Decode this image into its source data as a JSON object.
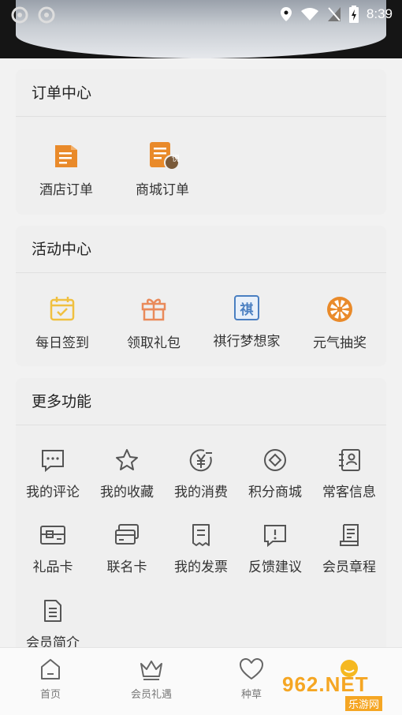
{
  "status_bar": {
    "time": "8:39"
  },
  "order_center": {
    "title": "订单中心",
    "items": [
      {
        "label": "酒店订单",
        "icon": "hotel-order-icon"
      },
      {
        "label": "商城订单",
        "icon": "mall-order-icon",
        "badge": "悦"
      }
    ]
  },
  "activity_center": {
    "title": "活动中心",
    "items": [
      {
        "label": "每日签到",
        "icon": "calendar-check-icon"
      },
      {
        "label": "领取礼包",
        "icon": "gift-icon"
      },
      {
        "label": "祺行梦想家",
        "icon": "qi-icon",
        "glyph": "祺"
      },
      {
        "label": "元气抽奖",
        "icon": "lottery-wheel-icon"
      }
    ]
  },
  "more_functions": {
    "title": "更多功能",
    "items": [
      {
        "label": "我的评论",
        "icon": "comment-icon"
      },
      {
        "label": "我的收藏",
        "icon": "star-icon"
      },
      {
        "label": "我的消费",
        "icon": "yen-icon"
      },
      {
        "label": "积分商城",
        "icon": "points-icon"
      },
      {
        "label": "常客信息",
        "icon": "contact-card-icon"
      },
      {
        "label": "礼品卡",
        "icon": "gift-card-icon"
      },
      {
        "label": "联名卡",
        "icon": "credit-card-icon"
      },
      {
        "label": "我的发票",
        "icon": "invoice-icon"
      },
      {
        "label": "反馈建议",
        "icon": "feedback-icon"
      },
      {
        "label": "会员章程",
        "icon": "scroll-icon"
      },
      {
        "label": "会员简介",
        "icon": "document-icon"
      }
    ]
  },
  "tab_bar": {
    "tabs": [
      {
        "label": "首页",
        "icon": "home-icon"
      },
      {
        "label": "会员礼遇",
        "icon": "crown-icon"
      },
      {
        "label": "种草",
        "icon": "heart-icon"
      }
    ]
  },
  "watermark": {
    "text_top": "962.NET",
    "text_bottom": "乐游网"
  },
  "colors": {
    "accent_orange": "#e98a2a",
    "accent_blue": "#4a7fc1",
    "icon_gray": "#555555",
    "yellow": "#f0c040"
  }
}
